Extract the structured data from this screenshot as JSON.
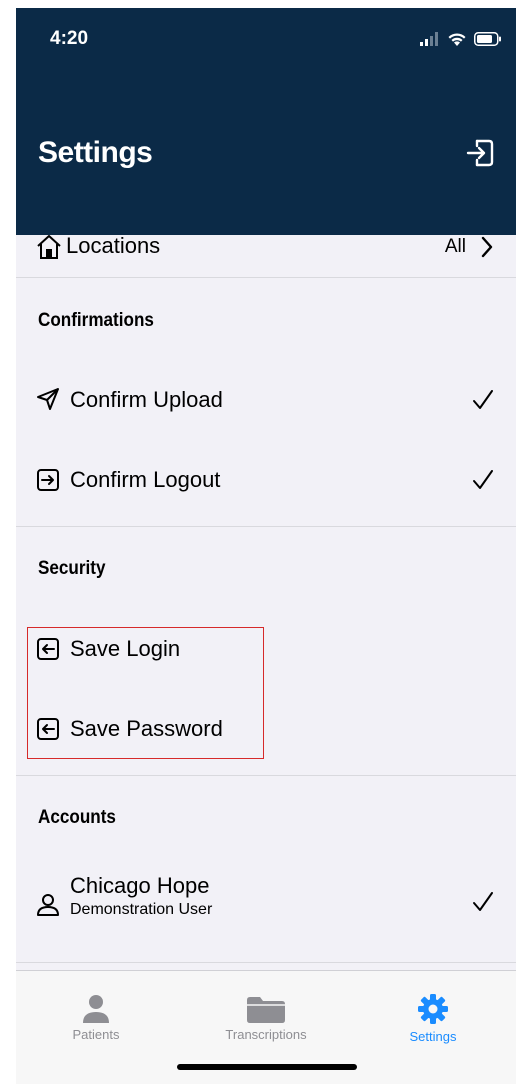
{
  "status_bar": {
    "time": "4:20"
  },
  "header": {
    "title": "Settings",
    "logout_icon": "logout-arrow-icon"
  },
  "locations": {
    "label": "Locations",
    "value": "All",
    "icon": "home-icon"
  },
  "sections": {
    "confirmations": {
      "title": "Confirmations",
      "items": [
        {
          "label": "Confirm Upload",
          "icon": "send-icon",
          "checked": true
        },
        {
          "label": "Confirm Logout",
          "icon": "box-arrow-right-icon",
          "checked": true
        }
      ]
    },
    "security": {
      "title": "Security",
      "items": [
        {
          "label": "Save Login",
          "icon": "box-arrow-left-icon",
          "checked": false
        },
        {
          "label": "Save Password",
          "icon": "box-arrow-left-icon",
          "checked": false
        }
      ]
    },
    "accounts": {
      "title": "Accounts",
      "items": [
        {
          "label": "Chicago Hope",
          "sublabel": "Demonstration User",
          "icon": "user-icon",
          "checked": true
        }
      ]
    }
  },
  "tabbar": {
    "tabs": [
      {
        "label": "Patients",
        "icon": "person-icon",
        "active": false
      },
      {
        "label": "Transcriptions",
        "icon": "folder-icon",
        "active": false
      },
      {
        "label": "Settings",
        "icon": "gear-icon",
        "active": true
      }
    ]
  },
  "colors": {
    "header_bg": "#0b2a47",
    "accent": "#1a8cff",
    "inactive_tab": "#8e8e93",
    "highlight_border": "#d62a2a"
  }
}
